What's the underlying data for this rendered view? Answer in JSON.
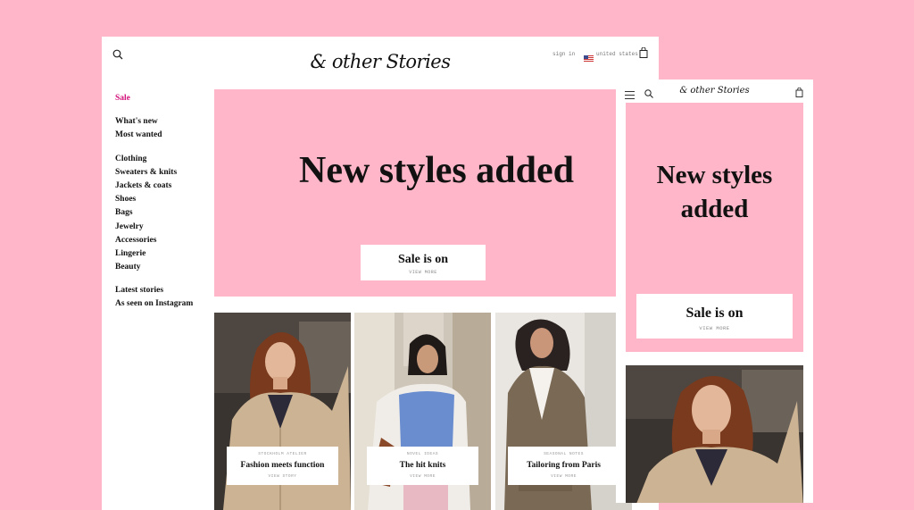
{
  "desktop": {
    "header": {
      "logo": "& other Stories",
      "sign_in": "sign in",
      "country": "united states",
      "search_icon": "search-icon",
      "bag_icon": "shopping-bag-icon"
    },
    "sidebar": {
      "sale": "Sale",
      "items_a": [
        "What's new",
        "Most wanted"
      ],
      "items_b": [
        "Clothing",
        "Sweaters & knits",
        "Jackets & coats",
        "Shoes",
        "Bags",
        "Jewelry",
        "Accessories",
        "Lingerie",
        "Beauty"
      ],
      "items_c": [
        "Latest stories",
        "As seen on Instagram"
      ]
    },
    "hero": {
      "title": "New styles added",
      "cta_title": "Sale is on",
      "cta_sub": "VIEW MORE"
    },
    "cards": [
      {
        "kicker": "STOCKHOLM ATELIER",
        "title": "Fashion meets function",
        "link": "VIEW STORY"
      },
      {
        "kicker": "NOVEL IDEAS",
        "title": "The hit knits",
        "link": "VIEW MORE"
      },
      {
        "kicker": "SEASONAL NOTES",
        "title": "Tailoring from Paris",
        "link": "VIEW MORE"
      }
    ]
  },
  "mobile": {
    "logo": "& other Stories",
    "hero_title": "New styles added",
    "cta_title": "Sale is on",
    "cta_sub": "VIEW MORE"
  },
  "colors": {
    "background": "#ffb6c8",
    "sale_accent": "#d4147b",
    "hero_pink": "#ffb6c8"
  }
}
